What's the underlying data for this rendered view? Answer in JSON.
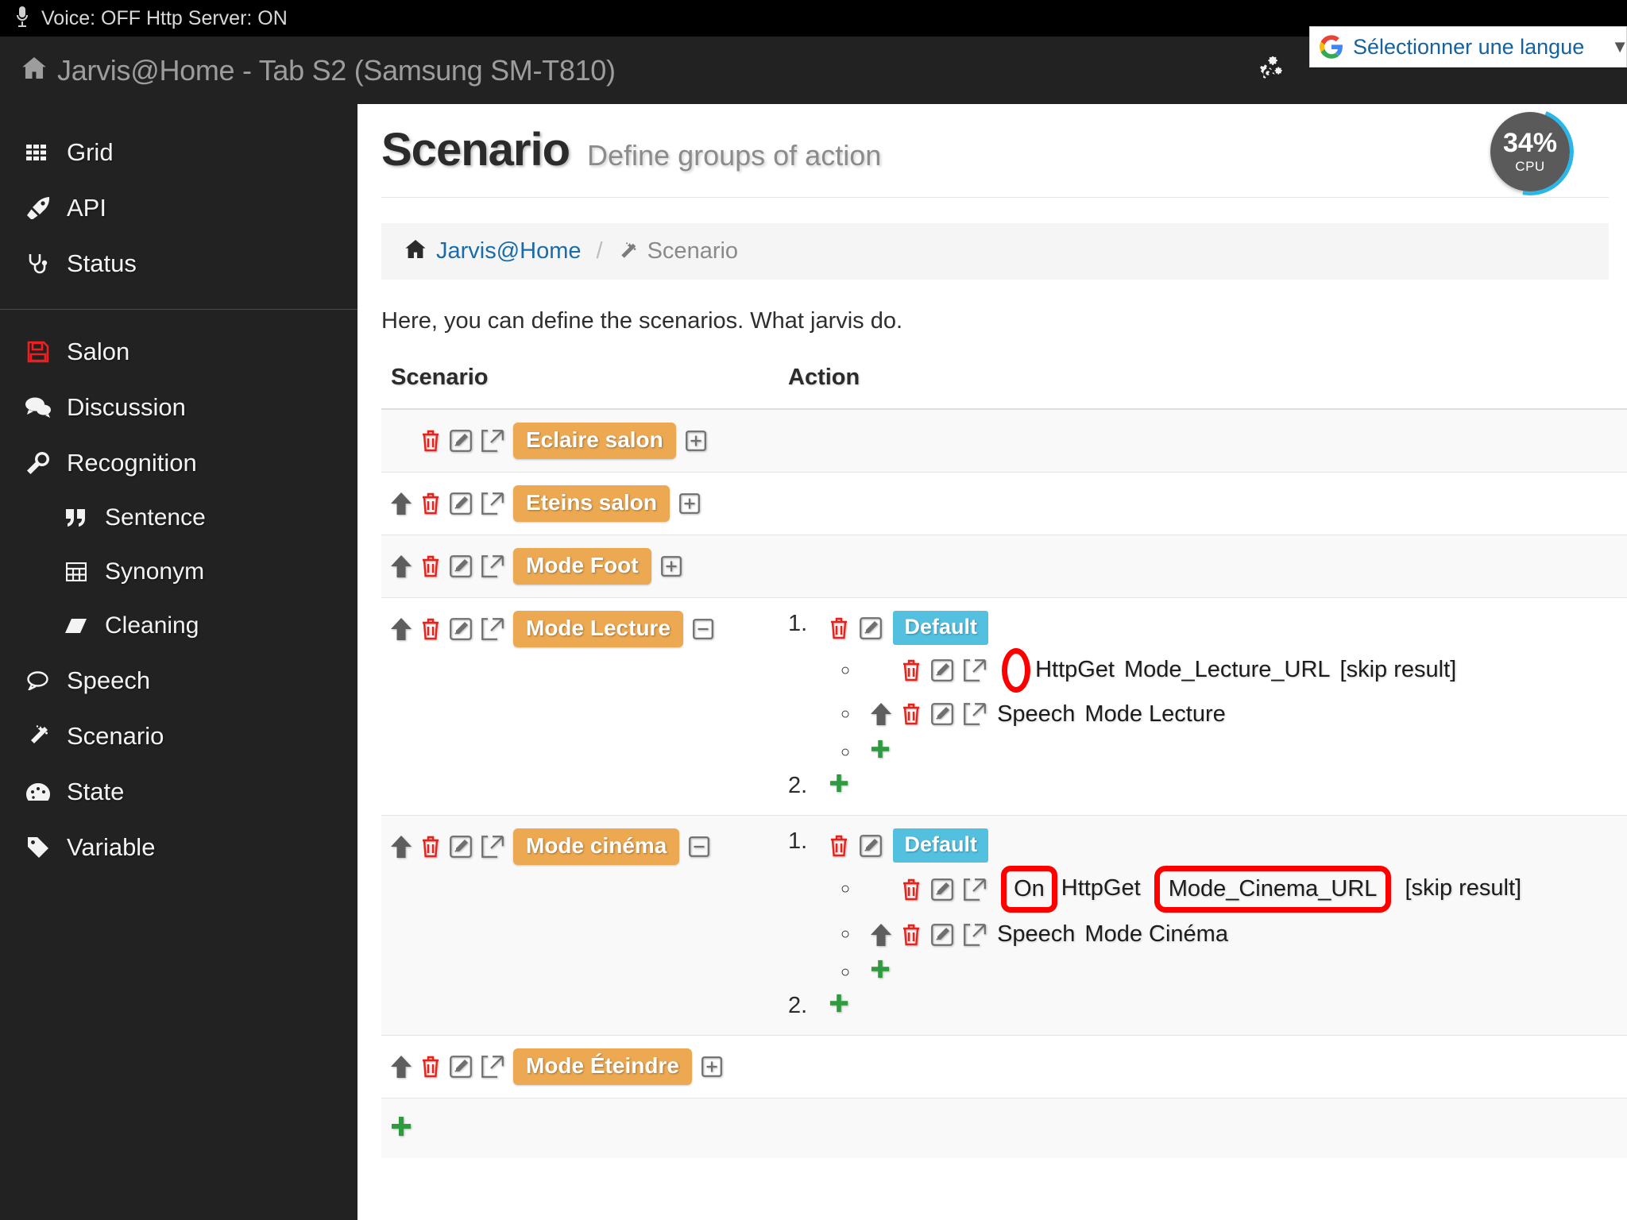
{
  "status_bar": {
    "mic_icon": "microphone-icon",
    "text": "Voice: OFF Http Server: ON"
  },
  "header": {
    "home_icon": "home-icon",
    "title": "Jarvis@Home - Tab S2 (Samsung SM-T810)",
    "settings_icon": "cogs-icon",
    "language_widget": {
      "logo_icon": "google-logo-icon",
      "label": "Sélectionner une langue",
      "caret_icon": "chevron-down-icon"
    }
  },
  "sidebar": {
    "groups": [
      {
        "items": [
          {
            "label": "Grid",
            "icon": "grid-icon"
          },
          {
            "label": "API",
            "icon": "rocket-icon"
          },
          {
            "label": "Status",
            "icon": "stethoscope-icon"
          }
        ]
      },
      {
        "items": [
          {
            "label": "Salon",
            "icon": "floppy-disk-icon"
          },
          {
            "label": "Discussion",
            "icon": "comments-icon"
          },
          {
            "label": "Recognition",
            "icon": "wrench-icon"
          },
          {
            "label": "Sentence",
            "icon": "quote-icon",
            "sub": true
          },
          {
            "label": "Synonym",
            "icon": "table-icon",
            "sub": true
          },
          {
            "label": "Cleaning",
            "icon": "eraser-icon",
            "sub": true
          },
          {
            "label": "Speech",
            "icon": "comment-icon"
          },
          {
            "label": "Scenario",
            "icon": "magic-wand-icon"
          },
          {
            "label": "State",
            "icon": "dashboard-icon"
          },
          {
            "label": "Variable",
            "icon": "tag-icon"
          }
        ]
      }
    ]
  },
  "page": {
    "title": "Scenario",
    "subtitle": "Define groups of action",
    "intro": "Here, you can define the scenarios. What jarvis do.",
    "cpu": {
      "value": "34%",
      "label": "CPU",
      "percent": 34,
      "arc_color": "#29b6e8"
    }
  },
  "breadcrumb": {
    "home_icon": "home-icon",
    "home_label": "Jarvis@Home",
    "separator": "/",
    "current_icon": "magic-wand-icon",
    "current_label": "Scenario"
  },
  "table": {
    "columns": [
      "Scenario",
      "Action"
    ],
    "rows": [
      {
        "name": "Eclaire salon",
        "has_move_up": false,
        "toggle_icon": "plus-square-icon",
        "actions": []
      },
      {
        "name": "Eteins salon",
        "has_move_up": true,
        "toggle_icon": "plus-square-icon",
        "actions": []
      },
      {
        "name": "Mode Foot",
        "has_move_up": true,
        "toggle_icon": "plus-square-icon",
        "actions": []
      },
      {
        "name": "Mode Lecture",
        "has_move_up": true,
        "toggle_icon": "minus-square-icon",
        "actions": [
          {
            "number": "1.",
            "badge": "Default",
            "steps": [
              {
                "has_move_up": false,
                "has_external": true,
                "prefix": "",
                "prefix_annotated": true,
                "prefix_annotation": "empty-oval",
                "command": "HttpGet",
                "param": "Mode_Lecture_URL",
                "param_annotated": false,
                "suffix": "[skip result]"
              },
              {
                "has_move_up": true,
                "has_external": true,
                "prefix": "",
                "prefix_annotated": false,
                "command": "Speech",
                "param": "Mode Lecture",
                "param_annotated": false,
                "suffix": ""
              },
              {
                "add_only": true,
                "add_icon": "plus-icon"
              }
            ]
          },
          {
            "number": "2.",
            "add_only": true,
            "add_icon": "plus-icon"
          }
        ]
      },
      {
        "name": "Mode cinéma",
        "has_move_up": true,
        "toggle_icon": "minus-square-icon",
        "actions": [
          {
            "number": "1.",
            "badge": "Default",
            "steps": [
              {
                "has_move_up": false,
                "has_external": true,
                "prefix": "On",
                "prefix_annotated": true,
                "prefix_annotation": "box",
                "command": "HttpGet",
                "param": "Mode_Cinema_URL",
                "param_annotated": true,
                "suffix": "[skip result]"
              },
              {
                "has_move_up": true,
                "has_external": true,
                "prefix": "",
                "prefix_annotated": false,
                "command": "Speech",
                "param": "Mode Cinéma",
                "param_annotated": false,
                "suffix": ""
              },
              {
                "add_only": true,
                "add_icon": "plus-icon"
              }
            ]
          },
          {
            "number": "2.",
            "add_only": true,
            "add_icon": "plus-icon"
          }
        ]
      },
      {
        "name": "Mode Éteindre",
        "has_move_up": true,
        "toggle_icon": "plus-square-icon",
        "actions": []
      }
    ],
    "footer_add_icon": "plus-icon"
  },
  "colors": {
    "badge_orange": "#eca952",
    "badge_blue": "#54c0e0",
    "trash_red": "#e8221a",
    "add_green": "#2e9b3f",
    "annotation_red": "#ff0000",
    "sidebar_bg": "#222222",
    "link_blue": "#1a6ca8"
  }
}
